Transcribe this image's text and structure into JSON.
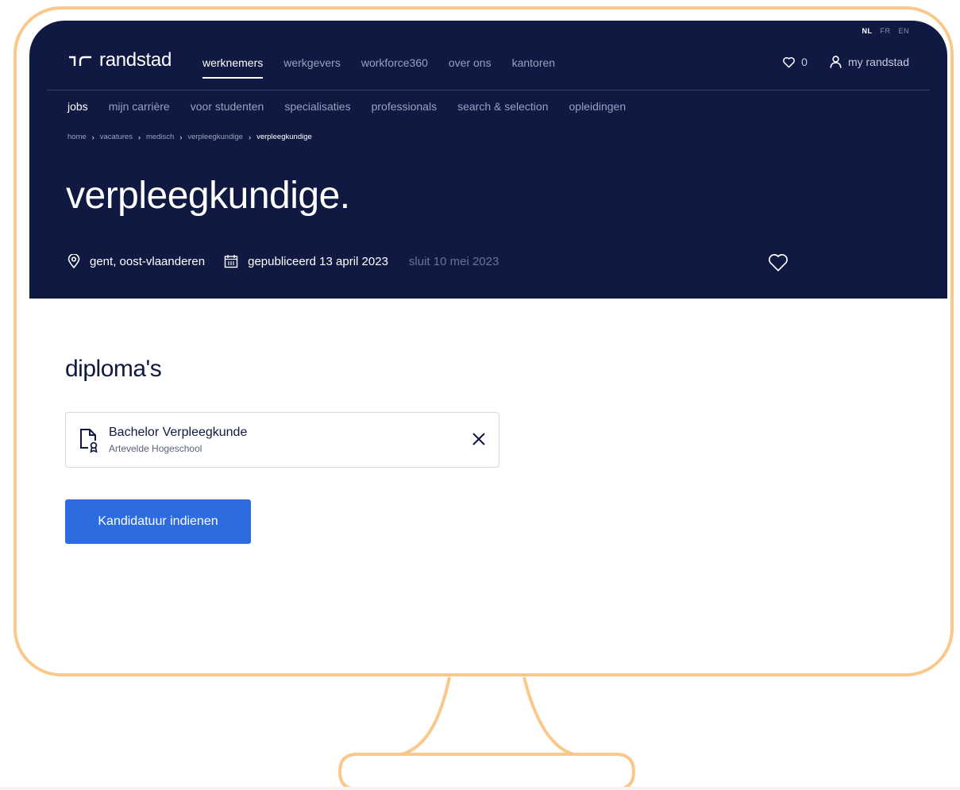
{
  "languages": [
    {
      "code": "NL",
      "active": true
    },
    {
      "code": "FR",
      "active": false
    },
    {
      "code": "EN",
      "active": false
    }
  ],
  "brand": {
    "name": "randstad",
    "logo_icon": "randstad-logo-icon",
    "color": "#0f1941"
  },
  "main_nav": {
    "items": [
      {
        "label": "werknemers",
        "active": true
      },
      {
        "label": "werkgevers",
        "active": false
      },
      {
        "label": "workforce360",
        "active": false
      },
      {
        "label": "over ons",
        "active": false
      },
      {
        "label": "kantoren",
        "active": false
      }
    ]
  },
  "header_right": {
    "favorites_icon": "heart-icon",
    "favorites_count": "0",
    "account_icon": "user-icon",
    "account_label": "my randstad"
  },
  "sub_nav": {
    "items": [
      {
        "label": "jobs",
        "active": true
      },
      {
        "label": "mijn carrière",
        "active": false
      },
      {
        "label": "voor studenten",
        "active": false
      },
      {
        "label": "specialisaties",
        "active": false
      },
      {
        "label": "professionals",
        "active": false
      },
      {
        "label": "search & selection",
        "active": false
      },
      {
        "label": "opleidingen",
        "active": false
      }
    ]
  },
  "breadcrumb": {
    "items": [
      "home",
      "vacatures",
      "medisch",
      "verpleegkundige"
    ],
    "separator": "›",
    "current": "verpleegkundige"
  },
  "job": {
    "title": "verpleegkundige.",
    "location_icon": "location-pin-icon",
    "location": "gent, oost-vlaanderen",
    "calendar_icon": "calendar-icon",
    "published": "gepubliceerd 13 april 2023",
    "closes": "sluit 10 mei 2023",
    "save_icon": "heart-icon"
  },
  "diplomas": {
    "section_title": "diploma's",
    "items": [
      {
        "icon": "certificate-icon",
        "name": "Bachelor Verpleegkunde",
        "school": "Artevelde Hogeschool",
        "remove_icon": "close-icon"
      }
    ]
  },
  "apply_button": {
    "label": "Kandidatuur indienen",
    "color": "#2d6cdf"
  },
  "frame": {
    "border_color": "#f9c88a"
  }
}
